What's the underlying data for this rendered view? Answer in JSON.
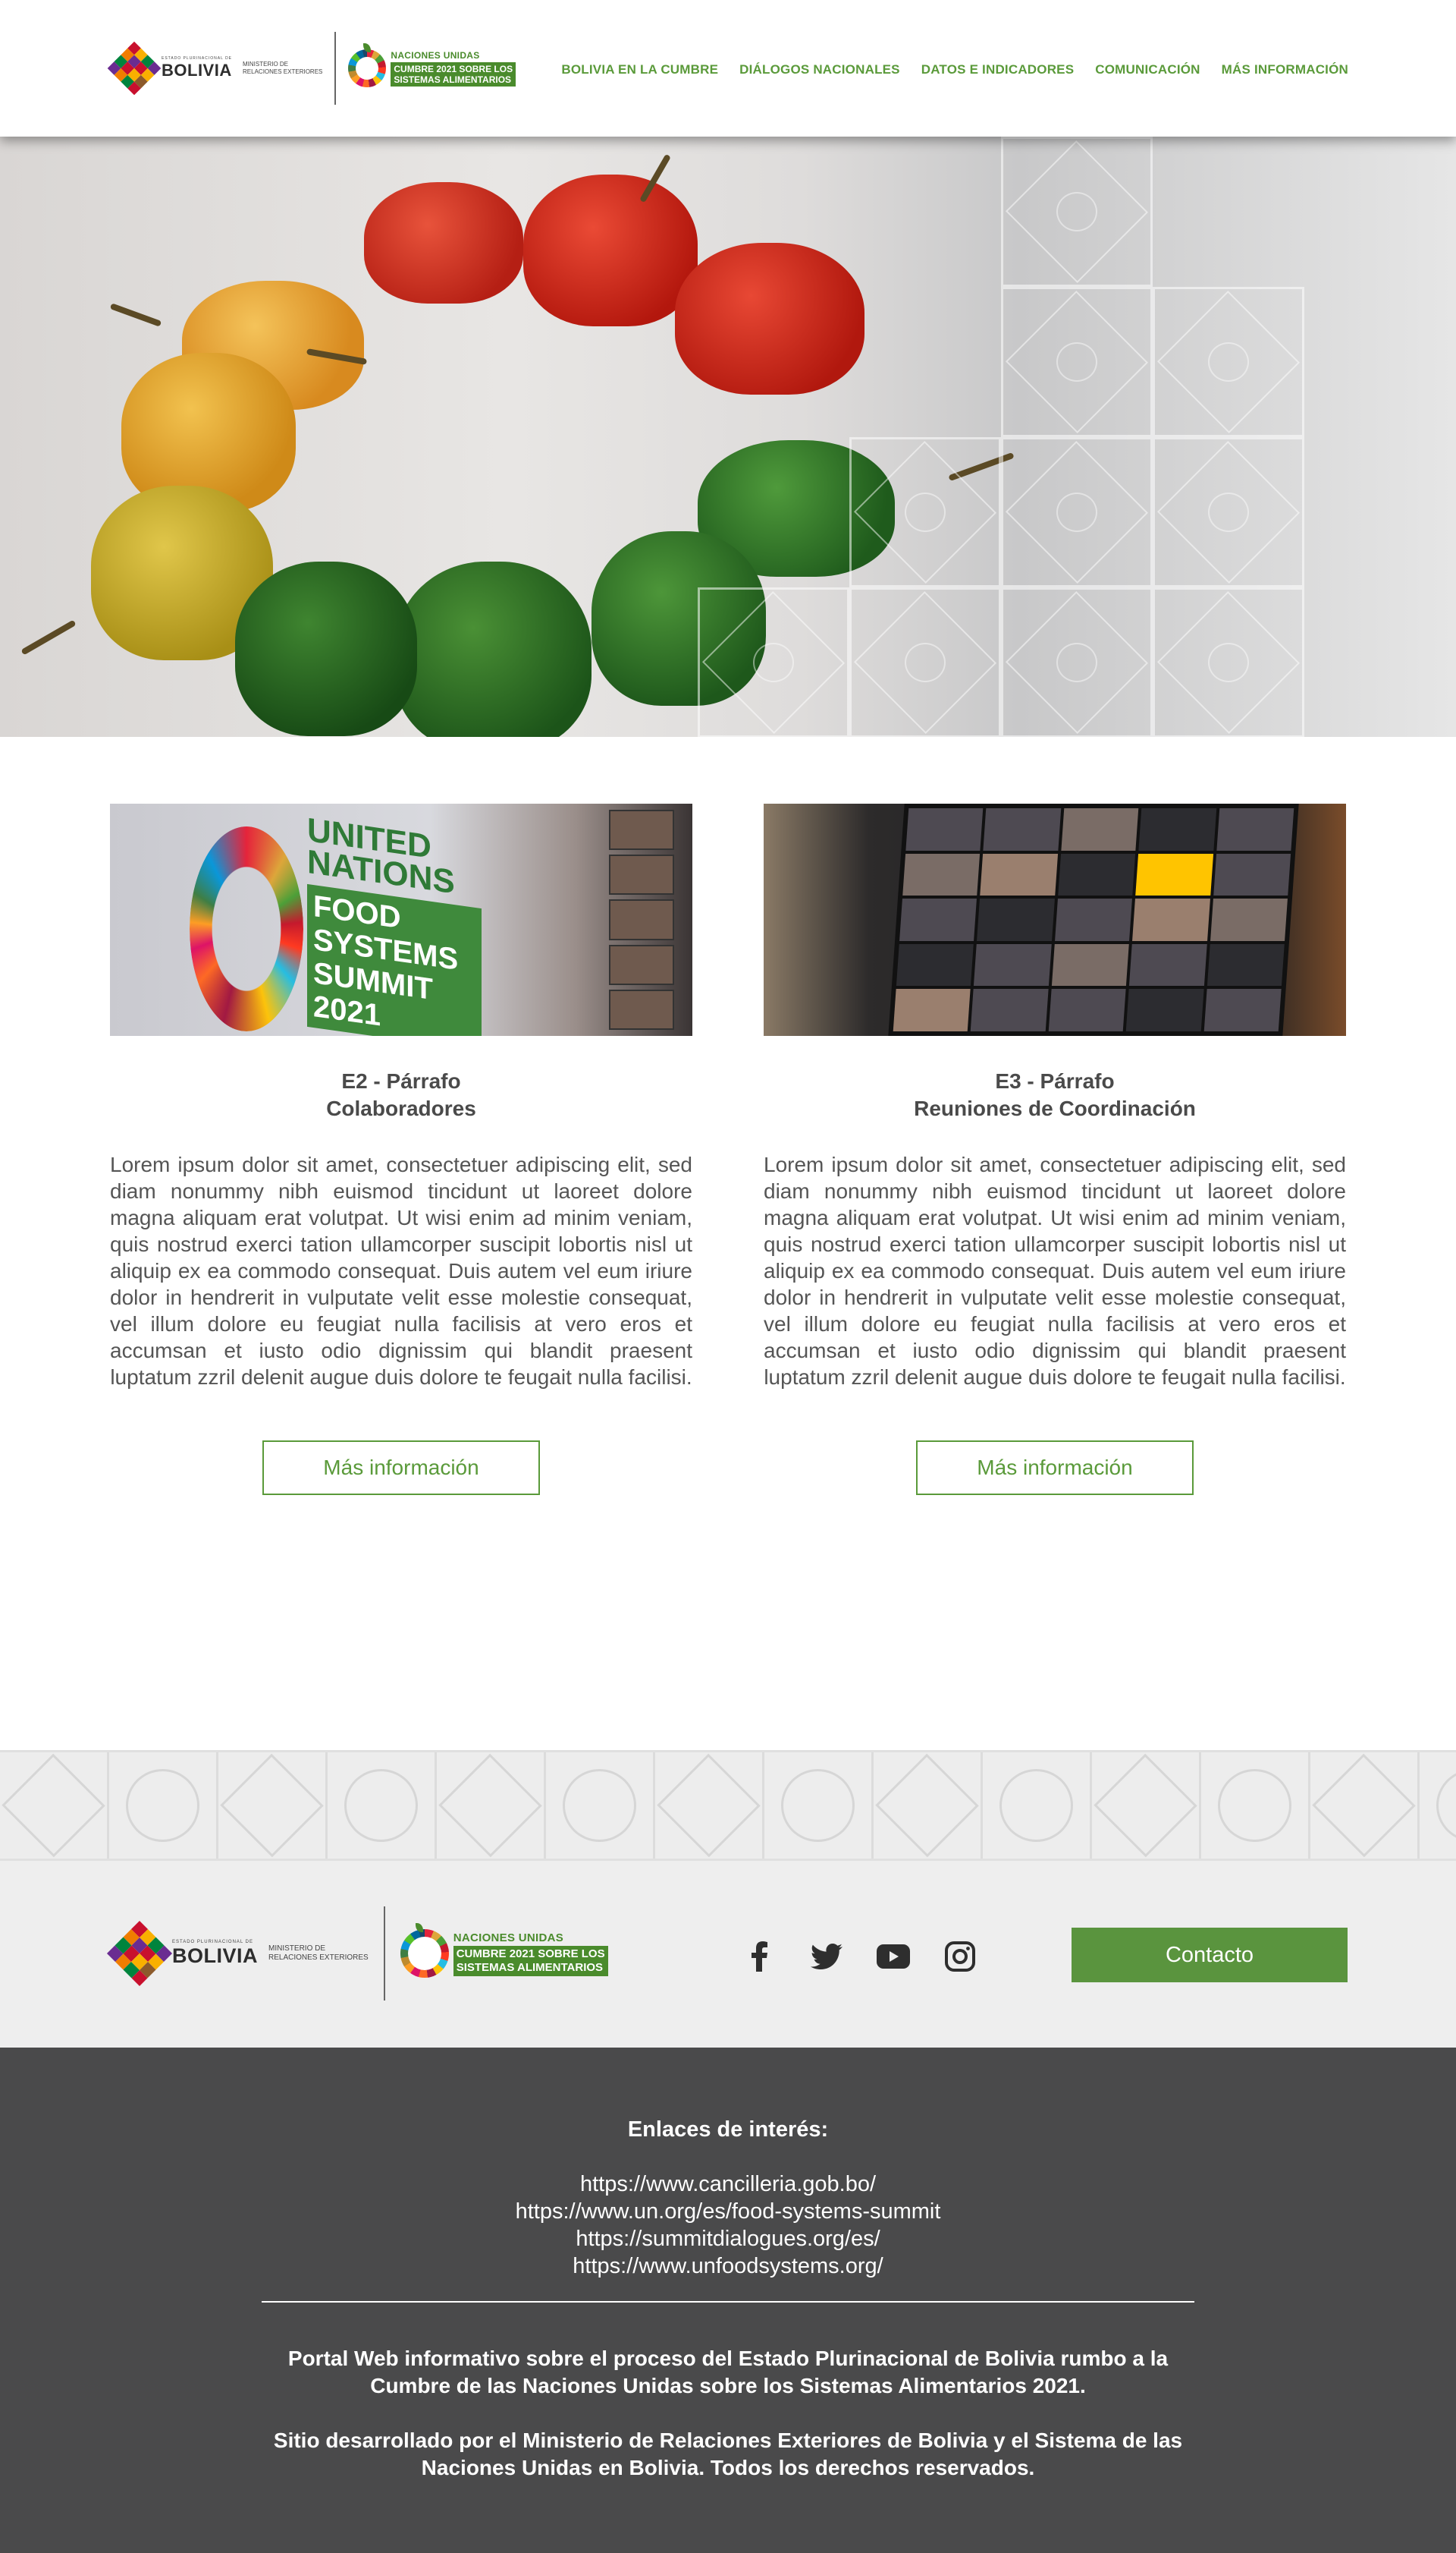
{
  "header": {
    "bolivia": {
      "small_text": "ESTADO PLURINACIONAL DE",
      "big_text": "BOLIVIA",
      "ministry_line1": "MINISTERIO DE",
      "ministry_line2": "RELACIONES EXTERIORES"
    },
    "un_logo": {
      "line1": "NACIONES UNIDAS",
      "line2": "CUMBRE 2021 SOBRE LOS",
      "line3": "SISTEMAS ALIMENTARIOS"
    },
    "nav": [
      {
        "label": "BOLIVIA EN LA CUMBRE"
      },
      {
        "label": "DIÁLOGOS NACIONALES"
      },
      {
        "label": "DATOS E INDICADORES"
      },
      {
        "label": "COMUNICACIÓN"
      },
      {
        "label": "MÁS INFORMACIÓN"
      }
    ]
  },
  "cards": [
    {
      "image_text": {
        "h1": "UNITED NATIONS",
        "h2": "FOOD SYSTEMS",
        "h3": "SUMMIT 2021"
      },
      "title_line1": "E2 - Párrafo",
      "title_line2": "Colaboradores",
      "body": "Lorem ipsum dolor sit amet, consectetuer adipiscing elit, sed diam nonummy nibh euismod tincidunt ut laoreet dolore magna aliquam erat volutpat. Ut wisi enim ad minim veniam, quis nostrud exerci tation ullamcorper suscipit lobortis nisl ut aliquip ex ea commodo consequat. Duis autem vel eum iriure dolor in hendrerit in vulputate velit esse molestie consequat, vel illum dolore eu feugiat nulla facilisis at vero eros et accumsan et iusto odio dignissim qui blandit praesent luptatum zzril delenit augue duis dolore te feugait nulla facilisi.",
      "button": "Más información"
    },
    {
      "title_line1": "E3 - Párrafo",
      "title_line2": "Reuniones de Coordinación",
      "body": "Lorem ipsum dolor sit amet, consectetuer adipiscing elit, sed diam nonummy nibh euismod tincidunt ut laoreet dolore magna aliquam erat volutpat. Ut wisi enim ad minim veniam, quis nostrud exerci tation ullamcorper suscipit lobortis nisl ut aliquip ex ea commodo consequat. Duis autem vel eum iriure dolor in hendrerit in vulputate velit esse molestie consequat, vel illum dolore eu feugiat nulla facilisis at vero eros et accumsan et iusto odio dignissim qui blandit praesent luptatum zzril delenit augue duis dolore te feugait nulla facilisi.",
      "button": "Más información"
    }
  ],
  "social": [
    {
      "icon": "facebook-icon"
    },
    {
      "icon": "twitter-icon"
    },
    {
      "icon": "youtube-icon"
    },
    {
      "icon": "instagram-icon"
    }
  ],
  "footer": {
    "contact_button": "Contacto",
    "links_title": "Enlaces de interés:",
    "links": [
      "https://www.cancilleria.gob.bo/",
      "https://www.un.org/es/food-systems-summit",
      "https://summitdialogues.org/es/",
      "https://www.unfoodsystems.org/"
    ],
    "para1": "Portal Web informativo sobre el proceso del Estado Plurinacional de Bolivia rumbo a la Cumbre de las Naciones Unidas sobre los Sistemas Alimentarios 2021.",
    "para2": "Sitio desarrollado por el Ministerio de Relaciones Exteriores de Bolivia y el Sistema de las Naciones Unidas en Bolivia. Todos los derechos reservados."
  },
  "colors": {
    "accent_green": "#5a9a3a",
    "footer_dark": "#4a4a4b",
    "footer_light": "#eeeeee"
  }
}
